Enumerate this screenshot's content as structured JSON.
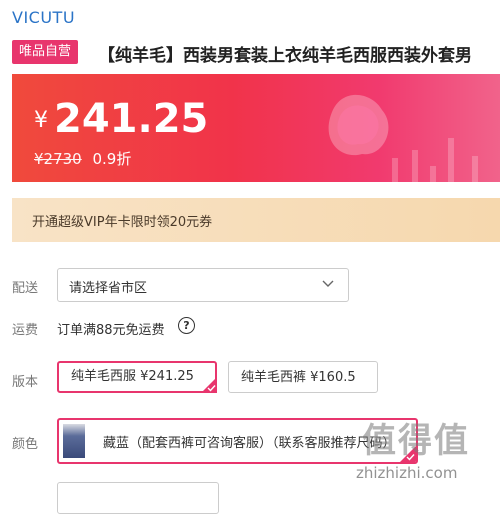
{
  "brand": "VICUTU",
  "product": {
    "tag": "唯品自营",
    "title": "【纯羊毛】西装男套装上衣纯羊毛西服西装外套男"
  },
  "price": {
    "currency": "¥",
    "current": "241.25",
    "original": "¥2730",
    "discount": "0.9折"
  },
  "vip_promo": "开通超级VIP年卡限时领20元券",
  "delivery": {
    "label": "配送",
    "placeholder": "请选择省市区",
    "icon": "chevron-down-icon"
  },
  "shipping": {
    "label": "运费",
    "text": "订单满88元免运费",
    "help_icon_text": "?"
  },
  "version": {
    "label": "版本",
    "options": [
      {
        "text": "纯羊毛西服 ¥241.25",
        "selected": true
      },
      {
        "text": "纯羊毛西裤 ¥160.5",
        "selected": false
      }
    ]
  },
  "color": {
    "label": "颜色",
    "option": "藏蓝（配套西裤可咨询客服）（联系客服推荐尺码）",
    "selected": true
  },
  "watermark": {
    "logo": "值得值",
    "site": "zhizhizhi.com"
  },
  "colors": {
    "accent": "#e8356d",
    "brand_blue": "#2b74c7",
    "banner_start": "#f04a3c",
    "banner_end": "#f1638b"
  }
}
